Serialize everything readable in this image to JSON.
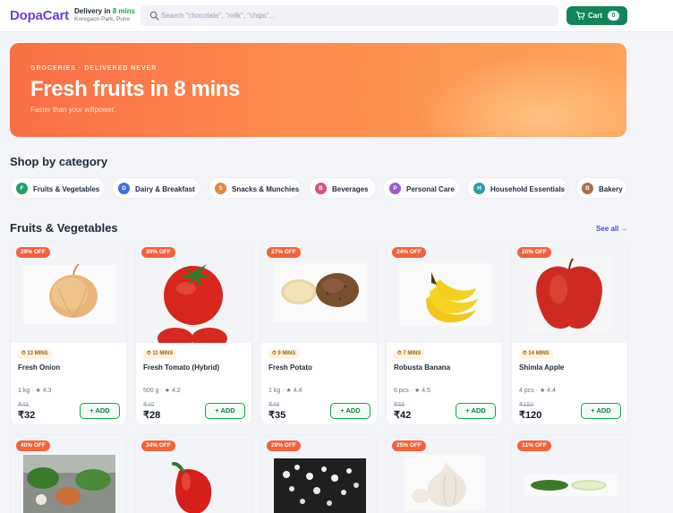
{
  "header": {
    "logo": "DopaCart",
    "delivery_prefix": "Delivery in ",
    "delivery_mins": "8 mins",
    "location": "Koregaon Park, Pune",
    "search_placeholder": "Search \"chocolate\", \"milk\", \"chips\"...",
    "cart_label": "Cart",
    "cart_count": "0"
  },
  "hero": {
    "kicker": "GROCERIES · DELIVERED NEVER",
    "title": "Fresh fruits in 8 mins",
    "subtitle": "Faster than your willpower."
  },
  "categories": {
    "title": "Shop by category",
    "items": [
      {
        "letter": "F",
        "label": "Fruits & Vegetables",
        "color": "#1f9d64"
      },
      {
        "letter": "D",
        "label": "Dairy & Breakfast",
        "color": "#3b6fe0"
      },
      {
        "letter": "S",
        "label": "Snacks & Munchies",
        "color": "#e8843c"
      },
      {
        "letter": "B",
        "label": "Beverages",
        "color": "#d9507a"
      },
      {
        "letter": "P",
        "label": "Personal Care",
        "color": "#9b5ad8"
      },
      {
        "letter": "H",
        "label": "Household Essentials",
        "color": "#2aa0a8"
      },
      {
        "letter": "B",
        "label": "Bakery",
        "color": "#a8704a"
      }
    ]
  },
  "products_section": {
    "title": "Fruits & Vegetables",
    "see_all": "See all →",
    "add_label": "+ ADD",
    "row1": [
      {
        "discount": "29% OFF",
        "eta": "⏱ 13 MINS",
        "name": "Fresh Onion",
        "meta": "1 kg · ★ 4.3",
        "mrp": "₹45",
        "price": "₹32",
        "icon": "onion-icon"
      },
      {
        "discount": "30% OFF",
        "eta": "⏱ 11 MINS",
        "name": "Fresh Tomato (Hybrid)",
        "meta": "500 g · ★ 4.2",
        "mrp": "₹40",
        "price": "₹28",
        "icon": "tomato-icon"
      },
      {
        "discount": "27% OFF",
        "eta": "⏱ 9 MINS",
        "name": "Fresh Potato",
        "meta": "1 kg · ★ 4.4",
        "mrp": "₹48",
        "price": "₹35",
        "icon": "potato-icon"
      },
      {
        "discount": "24% OFF",
        "eta": "⏱ 7 MINS",
        "name": "Robusta Banana",
        "meta": "6 pcs · ★ 4.5",
        "mrp": "₹55",
        "price": "₹42",
        "icon": "banana-icon"
      },
      {
        "discount": "20% OFF",
        "eta": "⏱ 14 MINS",
        "name": "Shimla Apple",
        "meta": "4 pcs · ★ 4.4",
        "mrp": "₹150",
        "price": "₹120",
        "icon": "apple-icon"
      }
    ],
    "row2": [
      {
        "discount": "40% OFF",
        "icon": "greens-icon"
      },
      {
        "discount": "34% OFF",
        "icon": "capsicum-icon"
      },
      {
        "discount": "29% OFF",
        "icon": "flowers-icon"
      },
      {
        "discount": "25% OFF",
        "icon": "garlic-icon"
      },
      {
        "discount": "31% OFF",
        "icon": "cucumber-icon"
      }
    ]
  },
  "colors": {
    "brand": "#6d3fe0",
    "cart_green": "#12855a",
    "discount": "#f4623a",
    "link": "#4f46e5"
  }
}
